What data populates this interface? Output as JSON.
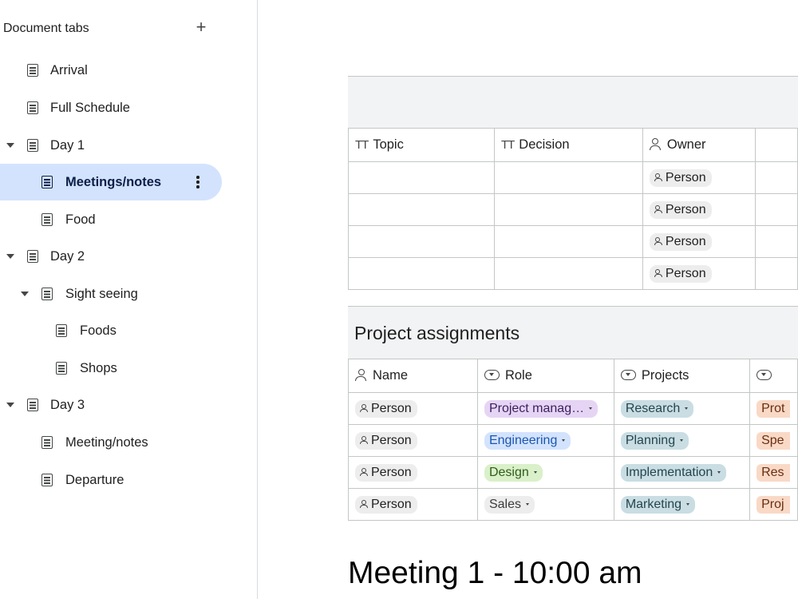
{
  "sidebar": {
    "title": "Document tabs",
    "add_icon": "plus-icon",
    "items": [
      {
        "label": "Arrival"
      },
      {
        "label": "Full Schedule"
      },
      {
        "label": "Day 1"
      },
      {
        "label": "Meetings/notes"
      },
      {
        "label": "Food"
      },
      {
        "label": "Day 2"
      },
      {
        "label": "Sight seeing"
      },
      {
        "label": "Foods"
      },
      {
        "label": "Shops"
      },
      {
        "label": "Day 3"
      },
      {
        "label": "Meeting/notes"
      },
      {
        "label": "Departure"
      }
    ]
  },
  "decisions_table": {
    "columns": [
      "Topic",
      "Decision",
      "Owner"
    ],
    "rows": [
      {
        "owner": "Person"
      },
      {
        "owner": "Person"
      },
      {
        "owner": "Person"
      },
      {
        "owner": "Person"
      }
    ]
  },
  "assignments": {
    "title": "Project assignments",
    "columns": [
      "Name",
      "Role",
      "Projects"
    ],
    "rows": [
      {
        "name": "Person",
        "role": "Project manag…",
        "project": "Research",
        "extra": "Prot"
      },
      {
        "name": "Person",
        "role": "Engineering",
        "project": "Planning",
        "extra": "Spe"
      },
      {
        "name": "Person",
        "role": "Design",
        "project": "Implementation",
        "extra": "Res"
      },
      {
        "name": "Person",
        "role": "Sales",
        "project": "Marketing",
        "extra": "Proj"
      }
    ]
  },
  "meeting_title": "Meeting 1 - 10:00 am",
  "colors": {
    "active_tab": "#d3e3fd",
    "role_pm": "#e6d4f5",
    "role_eng": "#d3e3fd",
    "role_design": "#d9f0c9",
    "role_sales": "#ededed",
    "project_chip": "#c9dde3",
    "extra_chip": "#f9d9c6"
  }
}
